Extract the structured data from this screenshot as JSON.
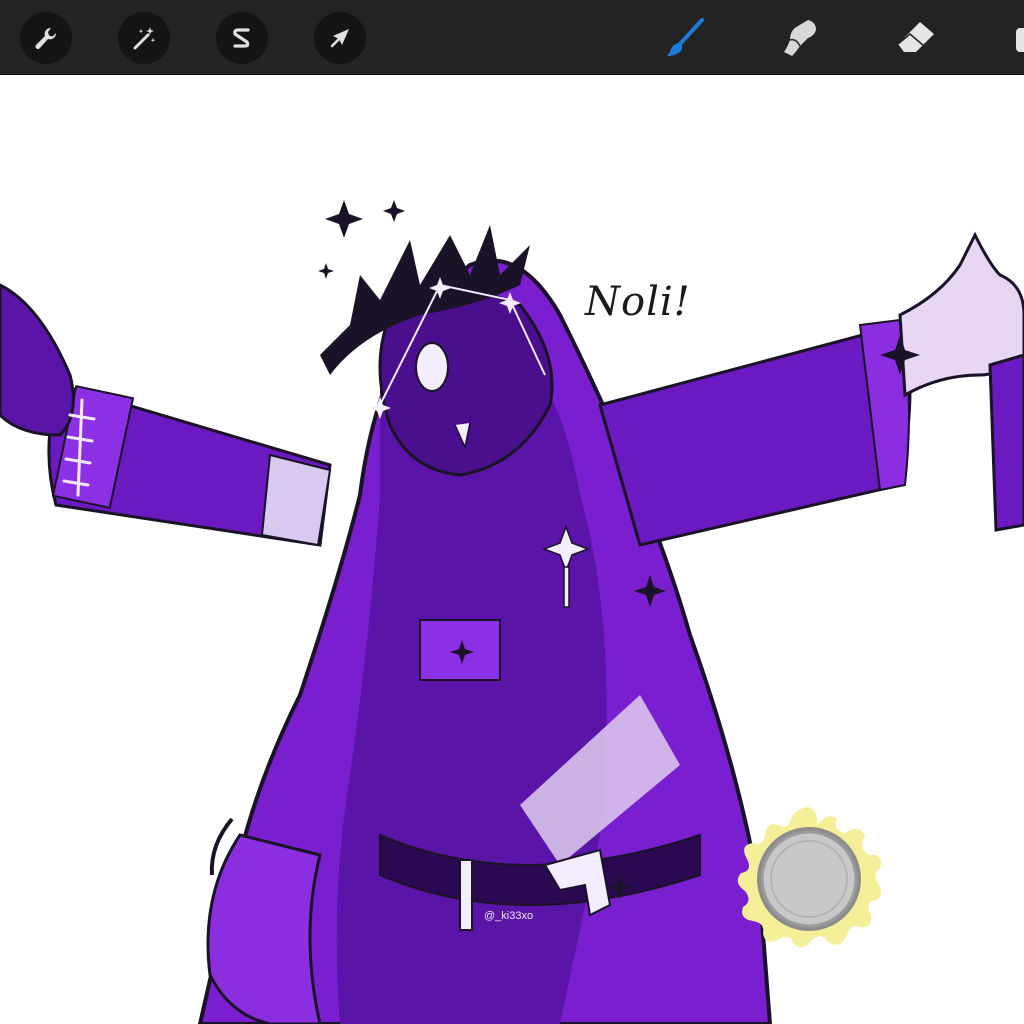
{
  "app": {
    "toolbar": {
      "left_tools": [
        {
          "name": "actions",
          "icon": "wrench-icon"
        },
        {
          "name": "adjustments",
          "icon": "magic-wand-icon"
        },
        {
          "name": "selection",
          "icon": "selection-s-icon"
        },
        {
          "name": "transform",
          "icon": "arrow-cursor-icon"
        }
      ],
      "right_tools": [
        {
          "name": "brush",
          "icon": "brush-icon",
          "active": true
        },
        {
          "name": "smudge",
          "icon": "smudge-finger-icon"
        },
        {
          "name": "eraser",
          "icon": "eraser-icon"
        }
      ],
      "active_color": "#1e7bdc"
    }
  },
  "canvas": {
    "caption": "Noli!",
    "signature": "@_ki33xo",
    "colors": {
      "primary_purple": "#7a1fd0",
      "dark_purple": "#3a0a6e",
      "highlight": "#e8d8f4",
      "ink": "#1a1226"
    }
  },
  "color_picker": {
    "current_color": "#c8c8c8",
    "splash_color": "#f6ef9a"
  }
}
